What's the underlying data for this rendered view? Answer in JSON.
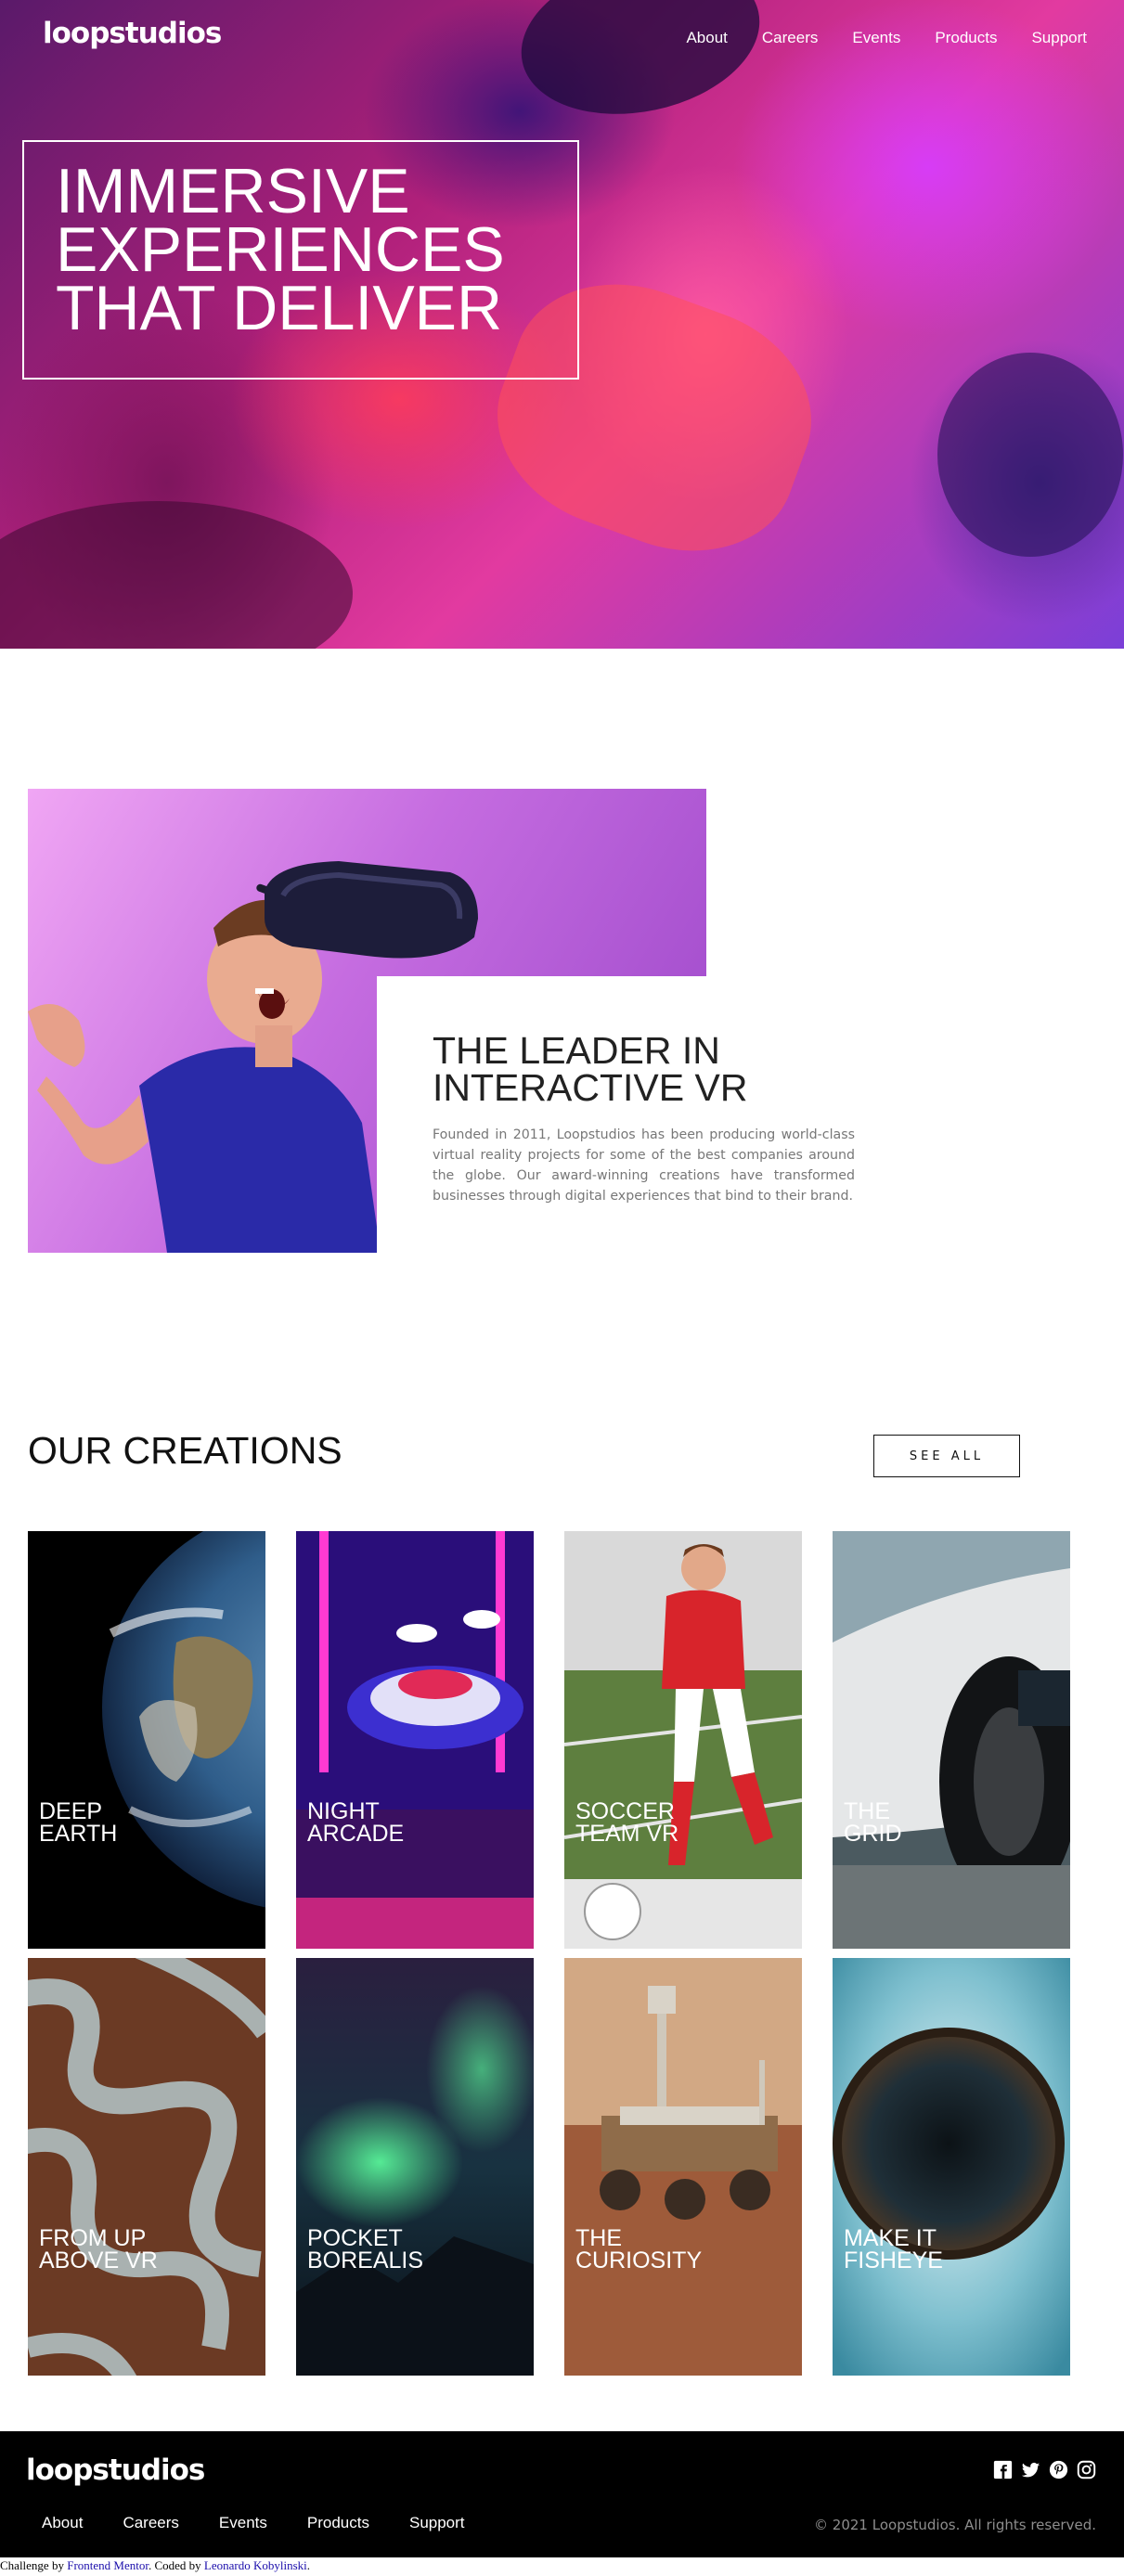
{
  "brand": {
    "logo": "loopstudios"
  },
  "nav": {
    "items": [
      "About",
      "Careers",
      "Events",
      "Products",
      "Support"
    ]
  },
  "hero": {
    "title_lines": [
      "IMMERSIVE",
      "EXPERIENCES",
      "THAT DELIVER"
    ]
  },
  "leader": {
    "title_lines": [
      "THE LEADER IN",
      "INTERACTIVE VR"
    ],
    "body": "Founded in 2011, Loopstudios has been producing world-class virtual reality projects for some of the best companies around the globe. Our award-winning creations have transformed businesses through digital experiences that bind to their brand."
  },
  "creations": {
    "title": "OUR CREATIONS",
    "see_all": "SEE ALL",
    "items": [
      {
        "lines": [
          "DEEP",
          "EARTH"
        ]
      },
      {
        "lines": [
          "NIGHT",
          "ARCADE"
        ]
      },
      {
        "lines": [
          "SOCCER",
          "TEAM VR"
        ]
      },
      {
        "lines": [
          "THE",
          "GRID"
        ]
      },
      {
        "lines": [
          "FROM UP",
          "ABOVE VR"
        ]
      },
      {
        "lines": [
          "POCKET",
          "BOREALIS"
        ]
      },
      {
        "lines": [
          "THE",
          "CURIOSITY"
        ]
      },
      {
        "lines": [
          "MAKE IT",
          "FISHEYE"
        ]
      }
    ]
  },
  "footer": {
    "logo": "loopstudios",
    "nav": [
      "About",
      "Careers",
      "Events",
      "Products",
      "Support"
    ],
    "copyright": "© 2021 Loopstudios. All rights reserved.",
    "socials": [
      "facebook-icon",
      "twitter-icon",
      "pinterest-icon",
      "instagram-icon"
    ]
  },
  "attribution": {
    "prefix": "Challenge by ",
    "link1": "Frontend Mentor",
    "middle": ". Coded by ",
    "link2": "Leonardo Kobylinski",
    "suffix": "."
  }
}
